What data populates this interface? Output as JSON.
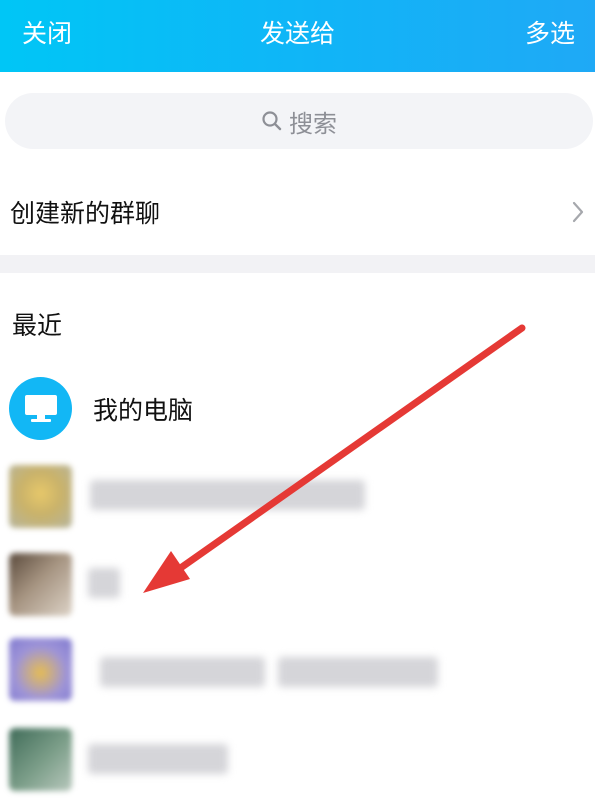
{
  "header": {
    "close_label": "关闭",
    "title": "发送给",
    "multiselect_label": "多选"
  },
  "search": {
    "placeholder": "搜索"
  },
  "create_group": {
    "label": "创建新的群聊"
  },
  "recent": {
    "title": "最近",
    "my_computer": "我的电脑"
  },
  "colors": {
    "header_start": "#00c6f6",
    "header_end": "#1fa9f6",
    "computer_avatar": "#12b7f5",
    "annotation_arrow": "#e53935"
  },
  "icons": {
    "search": "search-icon",
    "chevron": "chevron-right-icon",
    "computer": "monitor-icon"
  }
}
